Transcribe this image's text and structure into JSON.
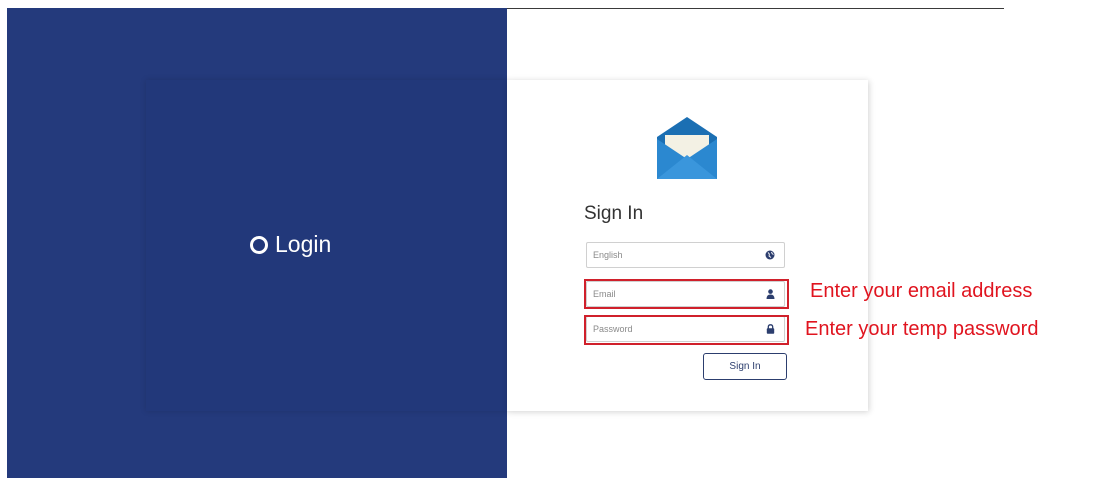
{
  "brand": {
    "label": "Login"
  },
  "form": {
    "title": "Sign In",
    "language": {
      "value": "English",
      "icon": "globe-icon"
    },
    "email": {
      "placeholder": "Email",
      "icon": "user-icon"
    },
    "password": {
      "placeholder": "Password",
      "icon": "lock-icon"
    },
    "submit_label": "Sign In"
  },
  "annotations": {
    "email_hint": "Enter your email address",
    "password_hint": "Enter your temp password",
    "highlight_color": "#d0202b"
  },
  "colors": {
    "panel": "#243a7c",
    "accent": "#2c3e6e",
    "logo_blue": "#1f7bc4"
  }
}
